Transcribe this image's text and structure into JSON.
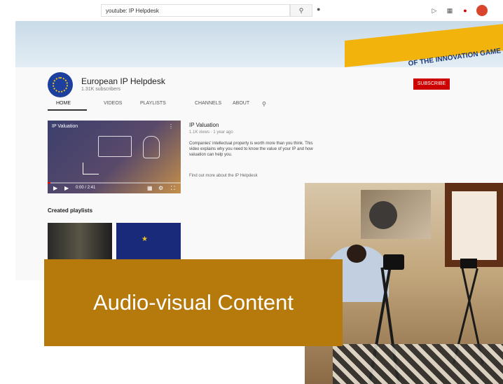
{
  "search": {
    "value": "youtube: IP Helpdesk"
  },
  "channel": {
    "name": "European IP Helpdesk",
    "subscribers": "1.31K subscribers",
    "subscribe_label": "SUBSCRIBE"
  },
  "tabs": [
    "HOME",
    "VIDEOS",
    "PLAYLISTS",
    "CHANNELS",
    "ABOUT"
  ],
  "video": {
    "player_title": "IP Valuation",
    "time": "0:00 / 2:41",
    "progress": 0.02,
    "info_title": "IP Valuation",
    "info_meta": "1.1K views · 1 year ago",
    "info_desc": "Companies' intellectual property is worth more than you think. This video explains why you need to know the value of your IP and how valuation can help you.",
    "info_link": "Find out more about the IP Helpdesk"
  },
  "playlists": {
    "heading": "Created playlists"
  },
  "banner_text": "OF THE INNOVATION GAME",
  "label": {
    "text": "Audio-visual Content"
  },
  "colors": {
    "label_bg": "#b5790c",
    "subscribe": "#cc0000",
    "logo": "#1d3f9e"
  }
}
